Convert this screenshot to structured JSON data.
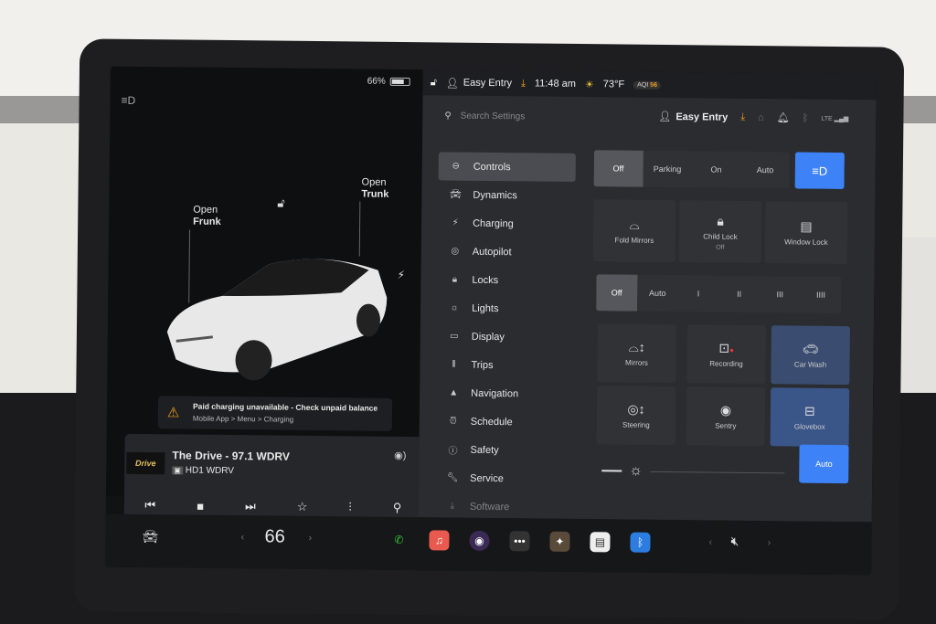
{
  "left_panel": {
    "battery_percent": "66%",
    "battery_level": 0.66,
    "headlight_indicator_icon": "auto-headlight-icon",
    "open_frunk": [
      "Open",
      "Frunk"
    ],
    "open_trunk": [
      "Open",
      "Trunk"
    ],
    "lock_icon": "unlocked-icon",
    "charge_icon": "lightning-icon",
    "alert": {
      "title": "Paid charging unavailable - Check unpaid balance",
      "subtitle": "Mobile App > Menu > Charging"
    },
    "media": {
      "station": "The Drive - 97.1 WDRV",
      "source": "HD1 WDRV",
      "logo_text": "Drive",
      "controls": [
        "prev",
        "stop",
        "next",
        "favorite",
        "equalizer",
        "search"
      ]
    }
  },
  "status_bar": {
    "profile": "Easy Entry",
    "time": "11:48 am",
    "temperature": "73°F",
    "aqi_label": "AQI",
    "aqi_value": "56"
  },
  "settings": {
    "search_placeholder": "Search Settings",
    "profile": "Easy Entry",
    "lte": "LTE",
    "menu": [
      {
        "label": "Controls",
        "icon": "toggle"
      },
      {
        "label": "Dynamics",
        "icon": "car"
      },
      {
        "label": "Charging",
        "icon": "bolt"
      },
      {
        "label": "Autopilot",
        "icon": "wheel"
      },
      {
        "label": "Locks",
        "icon": "lock"
      },
      {
        "label": "Lights",
        "icon": "sun"
      },
      {
        "label": "Display",
        "icon": "display"
      },
      {
        "label": "Trips",
        "icon": "trips"
      },
      {
        "label": "Navigation",
        "icon": "nav"
      },
      {
        "label": "Schedule",
        "icon": "clock"
      },
      {
        "label": "Safety",
        "icon": "info"
      },
      {
        "label": "Service",
        "icon": "wrench"
      },
      {
        "label": "Software",
        "icon": "download"
      }
    ],
    "lights_segment": [
      "Off",
      "Parking",
      "On",
      "Auto"
    ],
    "lights_active": "Off",
    "tiles_row1": [
      {
        "label": "Fold Mirrors",
        "sub": ""
      },
      {
        "label": "Child Lock",
        "sub": "Off"
      },
      {
        "label": "Window Lock",
        "sub": ""
      }
    ],
    "wiper_segment": [
      "Off",
      "Auto",
      "I",
      "II",
      "III",
      "IIII"
    ],
    "wiper_active": "Off",
    "tiles_row2": [
      {
        "label": "Mirrors"
      },
      {
        "label": "Recording"
      },
      {
        "label": "Car Wash"
      }
    ],
    "tiles_row3": [
      {
        "label": "Steering"
      },
      {
        "label": "Sentry"
      },
      {
        "label": "Glovebox"
      }
    ],
    "brightness_auto": "Auto"
  },
  "dock": {
    "temperature": "66",
    "apps": [
      "phone",
      "music",
      "camera",
      "more",
      "games",
      "notes",
      "bluetooth"
    ],
    "volume_icon": "mute-icon"
  },
  "colors": {
    "accent_blue": "#3e82f7",
    "warning": "#f0a020"
  }
}
